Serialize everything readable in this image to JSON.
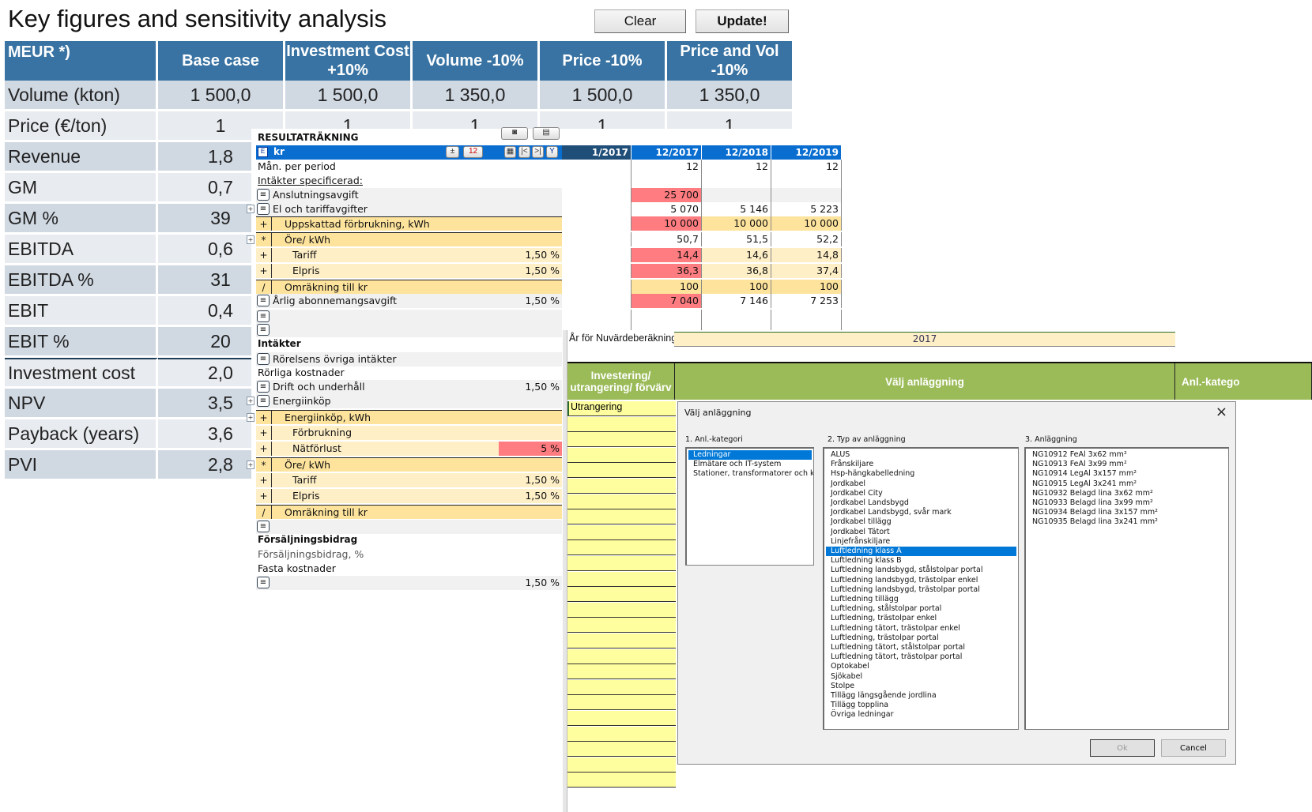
{
  "key_figures": {
    "title": "Key figures and sensitivity analysis",
    "buttons": {
      "clear": "Clear",
      "update": "Update!"
    },
    "columns": [
      "MEUR *)",
      "Base case",
      "Investment Cost +10%",
      "Volume -10%",
      "Price -10%",
      "Price and Vol -10%"
    ],
    "rows": [
      {
        "label": "Volume (kton)",
        "values": [
          "1 500,0",
          "1 500,0",
          "1 350,0",
          "1 500,0",
          "1 350,0"
        ]
      },
      {
        "label": "Price (€/ton)",
        "values": [
          "1",
          "1",
          "1",
          "1",
          "1"
        ]
      },
      {
        "label": "Revenue",
        "values": [
          "1,8"
        ]
      },
      {
        "label": "GM",
        "values": [
          "0,7"
        ]
      },
      {
        "label": "GM %",
        "values": [
          "39"
        ]
      },
      {
        "label": "EBITDA",
        "values": [
          "0,6"
        ]
      },
      {
        "label": "EBITDA %",
        "values": [
          "31"
        ]
      },
      {
        "label": "EBIT",
        "values": [
          "0,4"
        ]
      },
      {
        "label": "EBIT %",
        "values": [
          "20"
        ]
      },
      {
        "label": "Investment cost",
        "values": [
          "2,0"
        ]
      },
      {
        "label": "NPV",
        "values": [
          "3,5"
        ]
      },
      {
        "label": "Payback (years)",
        "values": [
          "3,6"
        ]
      },
      {
        "label": "PVI",
        "values": [
          "2,8"
        ]
      }
    ]
  },
  "income": {
    "title": "RESULTATRÄKNING",
    "unit": "kr",
    "periods": [
      "1/2017",
      "12/2017",
      "12/2018",
      "12/2019"
    ],
    "rows": [
      {
        "op": "",
        "label": "Mån. per period",
        "pct": "",
        "vals": [
          "",
          "12",
          "12",
          "12"
        ]
      },
      {
        "op": "",
        "label": "Intäkter specificerad:",
        "pct": "",
        "vals": [
          "",
          "",
          "",
          ""
        ]
      },
      {
        "op": "menu",
        "label": "Anslutningsavgift",
        "pct": "",
        "vals": [
          "",
          "25 700",
          "",
          ""
        ]
      },
      {
        "op": "menu",
        "label": "El och tariffavgifter",
        "pct": "",
        "vals": [
          "",
          "5 070",
          "5 146",
          "5 223"
        ]
      },
      {
        "op": "+",
        "label": "Uppskattad förbrukning, kWh",
        "pct": "",
        "vals": [
          "",
          "10 000",
          "10 000",
          "10 000"
        ]
      },
      {
        "op": "*",
        "label": "Öre/ kWh",
        "pct": "",
        "vals": [
          "",
          "50,7",
          "51,5",
          "52,2"
        ]
      },
      {
        "op": "+",
        "label": "Tariff",
        "pct": "1,50 %",
        "vals": [
          "",
          "14,4",
          "14,6",
          "14,8"
        ]
      },
      {
        "op": "+",
        "label": "Elpris",
        "pct": "1,50 %",
        "vals": [
          "",
          "36,3",
          "36,8",
          "37,4"
        ]
      },
      {
        "op": "/",
        "label": "Omräkning till kr",
        "pct": "",
        "vals": [
          "",
          "100",
          "100",
          "100"
        ]
      },
      {
        "op": "menu",
        "label": "Årlig abonnemangsavgift",
        "pct": "1,50 %",
        "vals": [
          "",
          "7 040",
          "7 146",
          "7 253"
        ]
      },
      {
        "op": "menu",
        "label": "",
        "pct": "",
        "vals": [
          "",
          "",
          "",
          ""
        ]
      },
      {
        "op": "menu",
        "label": "",
        "pct": "",
        "vals": [
          "",
          "",
          "",
          ""
        ]
      },
      {
        "op": "",
        "label": "Intäkter",
        "pct": "",
        "vals": []
      },
      {
        "op": "menu",
        "label": "Rörelsens övriga intäkter",
        "pct": "",
        "vals": []
      },
      {
        "op": "",
        "label": "Rörliga kostnader",
        "pct": "",
        "vals": []
      },
      {
        "op": "menu",
        "label": "Drift och underhåll",
        "pct": "1,50 %",
        "vals": []
      },
      {
        "op": "menu",
        "label": "Energiinköp",
        "pct": "",
        "vals": []
      },
      {
        "op": "+",
        "label": "Energiinköp, kWh",
        "pct": "",
        "vals": []
      },
      {
        "op": "+",
        "label": "Förbrukning",
        "pct": "",
        "vals": []
      },
      {
        "op": "+",
        "label": "Nätförlust",
        "pct": "5 %",
        "vals": []
      },
      {
        "op": "*",
        "label": "Öre/ kWh",
        "pct": "",
        "vals": []
      },
      {
        "op": "+",
        "label": "Tariff",
        "pct": "1,50 %",
        "vals": []
      },
      {
        "op": "+",
        "label": "Elpris",
        "pct": "1,50 %",
        "vals": []
      },
      {
        "op": "/",
        "label": "Omräkning till kr",
        "pct": "",
        "vals": []
      },
      {
        "op": "menu",
        "label": "",
        "pct": "",
        "vals": []
      },
      {
        "op": "",
        "label": "Försäljningsbidrag",
        "pct": "",
        "vals": []
      },
      {
        "op": "",
        "label": "Försäljningsbidrag, %",
        "pct": "",
        "vals": []
      },
      {
        "op": "",
        "label": "Fasta kostnader",
        "pct": "",
        "vals": []
      },
      {
        "op": "menu",
        "label": "",
        "pct": "1,50 %",
        "vals": []
      }
    ]
  },
  "investment": {
    "year_label": "År för Nuvärdeberäkning",
    "year_value": "2017",
    "col1": "Investering/ utrangering/ förvärv",
    "col2": "Välj anläggning",
    "col3": "Anl.-katego",
    "first_value": "Utrangering"
  },
  "dialog": {
    "title": "Välj anläggning",
    "close": "×",
    "list1_label": "1. Anl.-kategori",
    "list1": [
      "Ledningar",
      "Elmätare och IT-system",
      "Stationer, transformatorer och kri"
    ],
    "list1_selected": 0,
    "list2_label": "2. Typ av anläggning",
    "list2": [
      "ALUS",
      "Frånskiljare",
      "Hsp-hängkabelledning",
      "Jordkabel",
      "Jordkabel City",
      "Jordkabel Landsbygd",
      "Jordkabel Landsbygd, svår mark",
      "Jordkabel tillägg",
      "Jordkabel Tätort",
      "Linjefrånskiljare",
      "Luftledning klass A",
      "Luftledning klass B",
      "Luftledning landsbygd, stålstolpar portal",
      "Luftledning landsbygd, trästolpar enkel",
      "Luftledning landsbygd, trästolpar portal",
      "Luftledning tillägg",
      "Luftledning, stålstolpar portal",
      "Luftledning, trästolpar enkel",
      "Luftledning tätort, trästolpar enkel",
      "Luftledning, trästolpar portal",
      "Luftledning tätort, stålstolpar portal",
      "Luftledning tätort, trästolpar portal",
      "Optokabel",
      "Sjökabel",
      "Stolpe",
      "Tillägg längsgående jordlina",
      "Tillägg topplina",
      "Övriga ledningar"
    ],
    "list2_selected": 10,
    "list3_label": "3. Anläggning",
    "list3": [
      "NG10912 FeAl 3x62 mm²",
      "NG10913 FeAl 3x99 mm²",
      "NG10914 LegAl 3x157 mm²",
      "NG10915 LegAl 3x241 mm²",
      "NG10932 Belagd lina 3x62 mm²",
      "NG10933 Belagd lina 3x99 mm²",
      "NG10934 Belagd lina 3x157 mm²",
      "NG10935 Belagd lina 3x241 mm²"
    ],
    "ok": "Ok",
    "cancel": "Cancel"
  }
}
